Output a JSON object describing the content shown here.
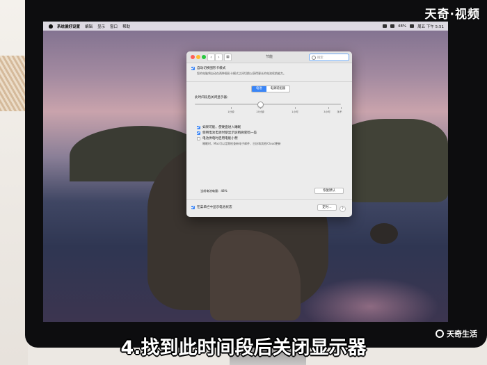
{
  "menubar": {
    "app_name": "系统偏好设置",
    "items": [
      "编辑",
      "显示",
      "窗口",
      "帮助"
    ],
    "battery": "48%",
    "clock": "周五 下午 5:51"
  },
  "window": {
    "title": "节能",
    "search_placeholder": "搜索",
    "auto_graphics": {
      "label": "自动切换图形卡模式",
      "description": "您的电脑将自动在两种图形卡模式之间切换以获得更长的电池续航能力。"
    },
    "tabs": [
      "电池",
      "电源适配器"
    ],
    "active_tab": 0,
    "slider": {
      "label": "此时间段后关闭显示器：",
      "ticks": [
        "1分钟",
        "15分钟",
        "1小时",
        "3小时",
        "永不"
      ],
      "value": "15分钟"
    },
    "options": [
      {
        "label": "如果可能，使硬盘进入睡眠",
        "checked": true
      },
      {
        "label": "使用电池电源时使显示屏稍微变暗一些",
        "checked": true
      },
      {
        "label": "电池供电时启用电能小憩",
        "checked": false,
        "description": "睡眠时，Mac可以定期检查新电子邮件、日历和其他iCloud更新"
      }
    ],
    "battery_level": "当前电池电量：48%",
    "restore_defaults": "恢复默认",
    "show_battery_status": "在菜单栏中显示电池状态",
    "schedule_button": "定时…",
    "help": "?"
  },
  "watermark_top": "天奇·视频",
  "watermark_bottom": "天奇生活",
  "subtitle": "4.找到此时间段后关闭显示器",
  "colors": {
    "accent": "#3a85f6"
  }
}
